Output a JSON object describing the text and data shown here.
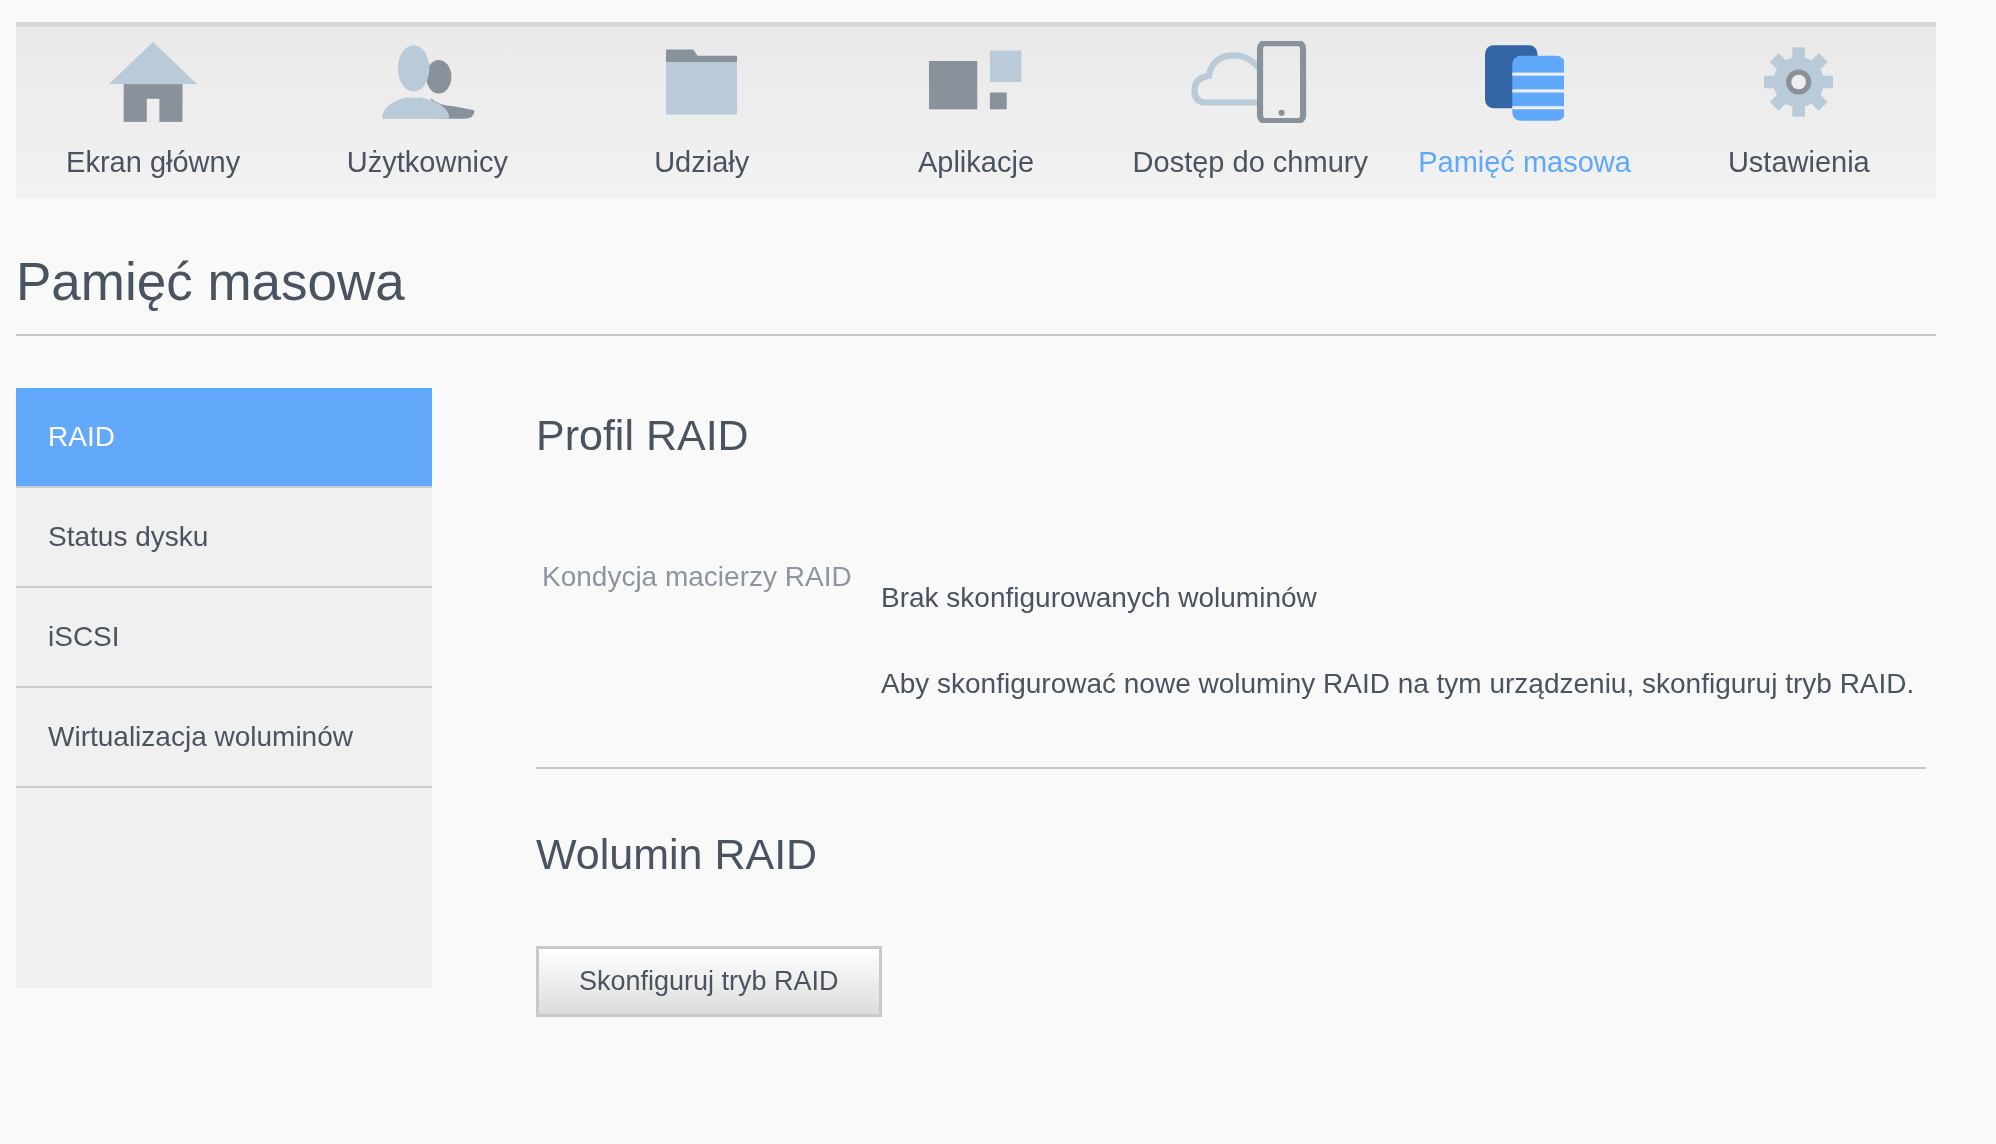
{
  "nav_tabs": [
    {
      "label": "Ekran główny",
      "selected": false
    },
    {
      "label": "Użytkownicy",
      "selected": false
    },
    {
      "label": "Udziały",
      "selected": false
    },
    {
      "label": "Aplikacje",
      "selected": false
    },
    {
      "label": "Dostęp do chmury",
      "selected": false
    },
    {
      "label": "Pamięć masowa",
      "selected": true
    },
    {
      "label": "Ustawienia",
      "selected": false
    }
  ],
  "page_title": "Pamięć masowa",
  "sidebar": {
    "items": [
      {
        "label": "RAID",
        "selected": true
      },
      {
        "label": "Status dysku",
        "selected": false
      },
      {
        "label": "iSCSI",
        "selected": false
      },
      {
        "label": "Wirtualizacja woluminów",
        "selected": false
      }
    ]
  },
  "sections": [
    {
      "title": "Profil RAID",
      "fields": [
        {
          "label": "Kondycja macierzy RAID",
          "value": "Brak skonfigurowanych woluminów",
          "note": "Aby skonfigurować nowe woluminy RAID na tym urządzeniu, skonfiguruj tryb RAID."
        }
      ]
    },
    {
      "title": "Wolumin RAID",
      "button": "Skonfiguruj tryb RAID"
    }
  ]
}
